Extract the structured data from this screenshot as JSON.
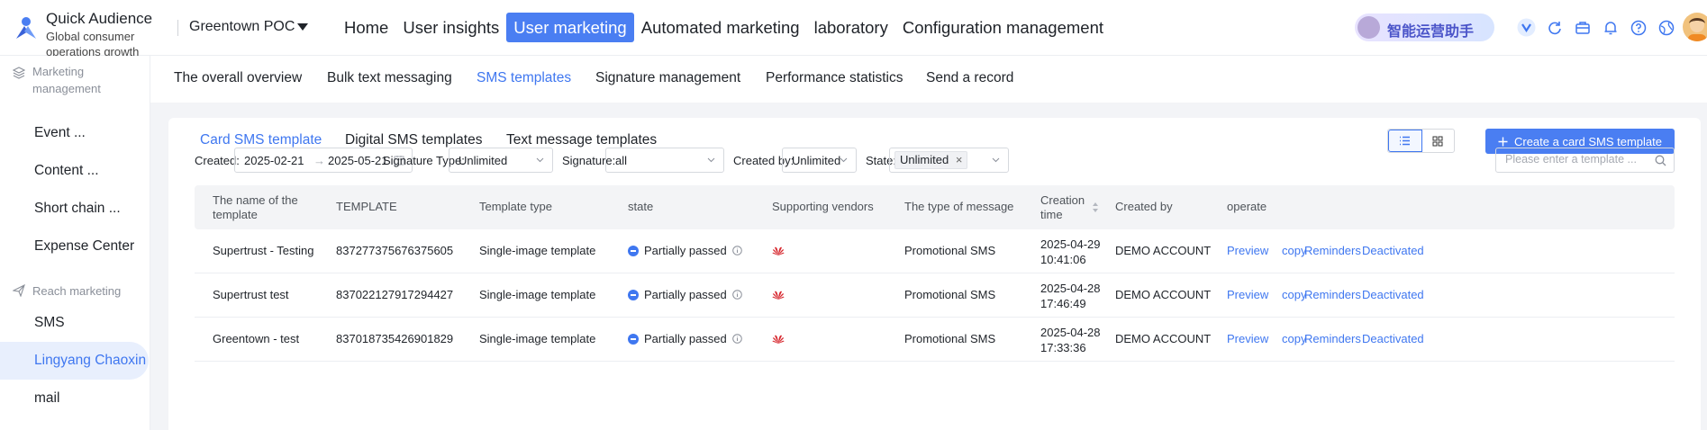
{
  "brand": {
    "name": "Quick Audience",
    "subtitle_line1": "Global consumer",
    "subtitle_line2": "operations growth"
  },
  "tenant": "Greentown POC",
  "main_nav": [
    "Home",
    "User insights",
    "User marketing",
    "Automated marketing",
    "laboratory",
    "Configuration management"
  ],
  "main_nav_active": "User marketing",
  "assistant_label": "智能运营助手",
  "sidebar": {
    "group1": "Marketing management",
    "group1_items": [
      "Event ...",
      "Content ...",
      "Short chain ...",
      "Expense Center"
    ],
    "group2": "Reach marketing",
    "group2_items": [
      "SMS",
      "Lingyang Chaoxin",
      "mail"
    ],
    "active": "Lingyang Chaoxin"
  },
  "sub_nav": [
    "The overall overview",
    "Bulk text messaging",
    "SMS templates",
    "Signature management",
    "Performance statistics",
    "Send a record"
  ],
  "sub_nav_active": "SMS templates",
  "tabs": [
    "Card SMS template",
    "Digital SMS templates",
    "Text message templates"
  ],
  "tabs_active": "Card SMS template",
  "create_button": "Create a card SMS template",
  "filters": {
    "created_label": "Created:",
    "date_from": "2025-02-21",
    "date_to": "2025-05-21",
    "date_arrow": "→",
    "signature_type_label": "Signature Type:",
    "signature_type_value": "Unlimited",
    "signature_label": "Signature:",
    "signature_value": "all",
    "created_by_label": "Created by:",
    "created_by_value": "Unlimited",
    "state_label": "State:",
    "state_tag": "Unlimited",
    "search_placeholder": "Please enter a template ..."
  },
  "table": {
    "headers": [
      "The name of the template",
      "TEMPLATE",
      "Template type",
      "state",
      "Supporting vendors",
      "The type of message",
      "Creation time",
      "Created by",
      "operate"
    ],
    "rows": [
      {
        "name": "Supertrust - Testing",
        "template": "837277375676375605",
        "type": "Single-image template",
        "state": "Partially passed",
        "message_type": "Promotional SMS",
        "date": "2025-04-29",
        "time": "10:41:06",
        "created_by": "DEMO ACCOUNT"
      },
      {
        "name": "Supertrust test",
        "template": "837022127917294427",
        "type": "Single-image template",
        "state": "Partially passed",
        "message_type": "Promotional SMS",
        "date": "2025-04-28",
        "time": "17:46:49",
        "created_by": "DEMO ACCOUNT"
      },
      {
        "name": "Greentown - test",
        "template": "837018735426901829",
        "type": "Single-image template",
        "state": "Partially passed",
        "message_type": "Promotional SMS",
        "date": "2025-04-28",
        "time": "17:33:36",
        "created_by": "DEMO ACCOUNT"
      }
    ],
    "actions": [
      "Preview",
      "copy",
      "Reminders",
      "Deactivated"
    ]
  },
  "colors": {
    "accent": "#3f77f0",
    "vendor": "#d7282f"
  }
}
